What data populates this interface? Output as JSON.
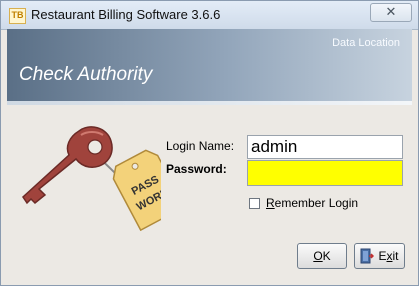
{
  "window": {
    "title": "Restaurant Billing Software 3.6.6",
    "app_icon_label": "TB",
    "close_glyph": "✕"
  },
  "header": {
    "data_location": "Data Location",
    "title": "Check Authority"
  },
  "key_tag": {
    "line1": "PASS",
    "line2": "WORD"
  },
  "form": {
    "login_label": "Login Name:",
    "login_value": "admin",
    "password_label": "Password:",
    "password_value": "",
    "remember_prefix": "R",
    "remember_rest": "emember Login",
    "remember_checked": false
  },
  "buttons": {
    "ok_underlined": "O",
    "ok_rest": "K",
    "exit_prefix": "E",
    "exit_underlined": "x",
    "exit_rest": "it"
  },
  "icons": {
    "exit": "door-exit-icon",
    "key": "key-icon"
  },
  "colors": {
    "password_bg": "#ffff00",
    "header_dark": "#5a6f86",
    "key": "#a0433c",
    "tag": "#f3d27a"
  }
}
